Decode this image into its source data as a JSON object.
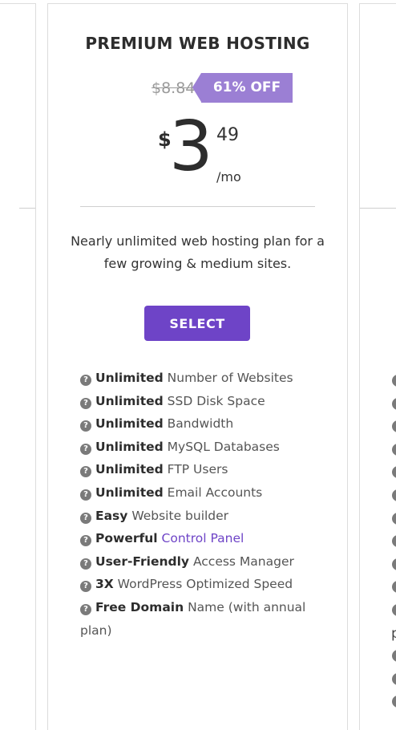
{
  "plan": {
    "title": "PREMIUM WEB HOSTING",
    "old_price": "$8.84",
    "discount": "61% OFF",
    "currency": "$",
    "price_whole": "3",
    "price_cents": "49",
    "period": "/mo",
    "description": "Nearly unlimited web hosting plan for a few growing & medium sites.",
    "select_label": "SELECT"
  },
  "features": [
    {
      "strong": "Unlimited",
      "text": " Number of Websites",
      "icon": "question-circle-icon"
    },
    {
      "strong": "Unlimited",
      "text": " SSD Disk Space",
      "icon": "question-circle-icon"
    },
    {
      "strong": "Unlimited",
      "text": " Bandwidth",
      "icon": "question-circle-icon"
    },
    {
      "strong": "Unlimited",
      "text": " MySQL Databases",
      "icon": "question-circle-icon"
    },
    {
      "strong": "Unlimited",
      "text": " FTP Users",
      "icon": "question-circle-icon"
    },
    {
      "strong": "Unlimited",
      "text": " Email Accounts",
      "icon": "question-circle-icon"
    },
    {
      "strong": "Easy",
      "text": " Website builder",
      "icon": "question-circle-icon"
    },
    {
      "strong": "Powerful",
      "link": "Control Panel",
      "icon": "question-circle-icon"
    },
    {
      "strong": "User-Friendly",
      "text": " Access Manager",
      "icon": "question-circle-icon"
    },
    {
      "strong": "3X",
      "text": " WordPress Optimized Speed",
      "icon": "question-circle-icon"
    },
    {
      "strong": "Free Domain",
      "text": " Name (with annual plan)",
      "icon": "question-circle-icon"
    }
  ],
  "right_card": {
    "peek_letter": "p"
  },
  "colors": {
    "accent": "#6e44c7",
    "badge": "#9b7fd4",
    "help_icon": "#7a7a7a"
  }
}
